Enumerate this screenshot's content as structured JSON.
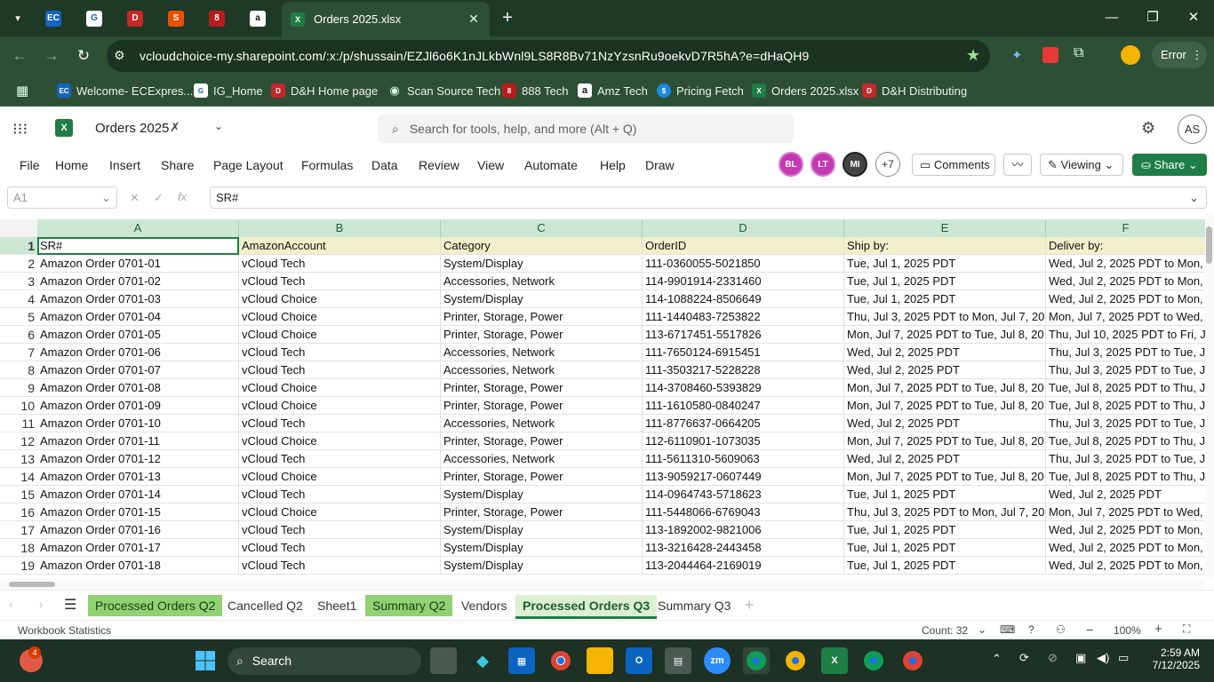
{
  "browser": {
    "active_tab_title": "Orders 2025.xlsx",
    "url": "vcloudchoice-my.sharepoint.com/:x:/p/shussain/EZJl6o6K1nJLkbWnl9LS8R8Bv71NzYzsnRu9oekvD7R5hA?e=dHaQH9",
    "profile_status": "Error",
    "bookmarks": [
      {
        "label": "Welcome- ECExpres...",
        "icon": "ec-icon"
      },
      {
        "label": "IG_Home",
        "icon": "ig-icon"
      },
      {
        "label": "D&H Home page",
        "icon": "dh-icon"
      },
      {
        "label": "Scan Source Tech",
        "icon": "globe-icon"
      },
      {
        "label": "888 Tech",
        "icon": "888-icon"
      },
      {
        "label": "Amz Tech",
        "icon": "amazon-icon"
      },
      {
        "label": "Pricing Fetch",
        "icon": "pricing-icon"
      },
      {
        "label": "Orders 2025.xlsx",
        "icon": "excel-icon"
      },
      {
        "label": "D&H Distributing",
        "icon": "dh-icon"
      }
    ]
  },
  "excel": {
    "workbook_title": "Orders 2025",
    "search_placeholder": "Search for tools, help, and more (Alt + Q)",
    "user_initials": "AS",
    "ribbon_tabs": [
      "File",
      "Home",
      "Insert",
      "Share",
      "Page Layout",
      "Formulas",
      "Data",
      "Review",
      "View",
      "Automate",
      "Help",
      "Draw"
    ],
    "presence": [
      "BL",
      "LT",
      "MI"
    ],
    "presence_more": "+7",
    "comments_label": "Comments",
    "viewing_label": "Viewing",
    "share_label": "Share",
    "name_box": "A1",
    "formula_value": "SR#",
    "columns": [
      "A",
      "B",
      "C",
      "D",
      "E",
      "F"
    ],
    "header_row": [
      "SR#",
      "AmazonAccount",
      "Category",
      "OrderID",
      "Ship by:",
      "Deliver by:"
    ],
    "rows": [
      [
        "2",
        "Amazon Order 0701-01",
        "vCloud Tech",
        "System/Display",
        "111-0360055-5021850",
        "Tue, Jul 1, 2025 PDT",
        "Wed, Jul 2, 2025 PDT to Mon,"
      ],
      [
        "3",
        "Amazon Order 0701-02",
        "vCloud Tech",
        "Accessories, Network",
        "114-9901914-2331460",
        "Tue, Jul 1, 2025 PDT",
        "Wed, Jul 2, 2025 PDT to Mon,"
      ],
      [
        "4",
        "Amazon Order 0701-03",
        "vCloud Choice",
        "System/Display",
        "114-1088224-8506649",
        "Tue, Jul 1, 2025 PDT",
        "Wed, Jul 2, 2025 PDT to Mon,"
      ],
      [
        "5",
        "Amazon Order 0701-04",
        "vCloud Choice",
        "Printer, Storage, Power",
        "111-1440483-7253822",
        "Thu, Jul 3, 2025 PDT to Mon, Jul 7, 20",
        "Mon, Jul 7, 2025 PDT to Wed,"
      ],
      [
        "6",
        "Amazon Order 0701-05",
        "vCloud Choice",
        "Printer, Storage, Power",
        "113-6717451-5517826",
        "Mon, Jul 7, 2025 PDT to Tue, Jul 8, 20",
        "Thu, Jul 10, 2025 PDT to Fri, J"
      ],
      [
        "7",
        "Amazon Order 0701-06",
        "vCloud Tech",
        "Accessories, Network",
        "111-7650124-6915451",
        "Wed, Jul 2, 2025 PDT",
        "Thu, Jul 3, 2025 PDT to Tue, Ju"
      ],
      [
        "8",
        "Amazon Order 0701-07",
        "vCloud Tech",
        "Accessories, Network",
        "111-3503217-5228228",
        "Wed, Jul 2, 2025 PDT",
        "Thu, Jul 3, 2025 PDT to Tue, Ju"
      ],
      [
        "9",
        "Amazon Order 0701-08",
        "vCloud Choice",
        "Printer, Storage, Power",
        "114-3708460-5393829",
        "Mon, Jul 7, 2025 PDT to Tue, Jul 8, 20",
        "Tue, Jul 8, 2025 PDT to Thu, Ju"
      ],
      [
        "10",
        "Amazon Order 0701-09",
        "vCloud Choice",
        "Printer, Storage, Power",
        "111-1610580-0840247",
        "Mon, Jul 7, 2025 PDT to Tue, Jul 8, 20",
        "Tue, Jul 8, 2025 PDT to Thu, Ju"
      ],
      [
        "11",
        "Amazon Order 0701-10",
        "vCloud Tech",
        "Accessories, Network",
        "111-8776637-0664205",
        "Wed, Jul 2, 2025 PDT",
        "Thu, Jul 3, 2025 PDT to Tue, Ju"
      ],
      [
        "12",
        "Amazon Order 0701-11",
        "vCloud Choice",
        "Printer, Storage, Power",
        "112-6110901-1073035",
        "Mon, Jul 7, 2025 PDT to Tue, Jul 8, 20",
        "Tue, Jul 8, 2025 PDT to Thu, Ju"
      ],
      [
        "13",
        "Amazon Order 0701-12",
        "vCloud Tech",
        "Accessories, Network",
        "111-5611310-5609063",
        "Wed, Jul 2, 2025 PDT",
        "Thu, Jul 3, 2025 PDT to Tue, Ju"
      ],
      [
        "14",
        "Amazon Order 0701-13",
        "vCloud Choice",
        "Printer, Storage, Power",
        "113-9059217-0607449",
        "Mon, Jul 7, 2025 PDT to Tue, Jul 8, 20",
        "Tue, Jul 8, 2025 PDT to Thu, Ju"
      ],
      [
        "15",
        "Amazon Order 0701-14",
        "vCloud Tech",
        "System/Display",
        "114-0964743-5718623",
        "Tue, Jul 1, 2025 PDT",
        "Wed, Jul 2, 2025 PDT"
      ],
      [
        "16",
        "Amazon Order 0701-15",
        "vCloud Choice",
        "Printer, Storage, Power",
        "111-5448066-6769043",
        "Thu, Jul 3, 2025 PDT to Mon, Jul 7, 20",
        "Mon, Jul 7, 2025 PDT to Wed,"
      ],
      [
        "17",
        "Amazon Order 0701-16",
        "vCloud Tech",
        "System/Display",
        "113-1892002-9821006",
        "Tue, Jul 1, 2025 PDT",
        "Wed, Jul 2, 2025 PDT to Mon,"
      ],
      [
        "18",
        "Amazon Order 0701-17",
        "vCloud Tech",
        "System/Display",
        "113-3216428-2443458",
        "Tue, Jul 1, 2025 PDT",
        "Wed, Jul 2, 2025 PDT to Mon,"
      ],
      [
        "19",
        "Amazon Order 0701-18",
        "vCloud Tech",
        "System/Display",
        "113-2044464-2169019",
        "Tue, Jul 1, 2025 PDT",
        "Wed, Jul 2, 2025 PDT to Mon,"
      ]
    ],
    "sheets": [
      {
        "label": "Processed Orders Q2",
        "color": "green"
      },
      {
        "label": "Cancelled Q2",
        "color": ""
      },
      {
        "label": "Sheet1",
        "color": ""
      },
      {
        "label": "Summary Q2",
        "color": "green"
      },
      {
        "label": "Vendors",
        "color": ""
      },
      {
        "label": "Processed Orders Q3",
        "color": "active"
      },
      {
        "label": "Summary Q3",
        "color": ""
      }
    ],
    "status_left": "Workbook Statistics",
    "status_count": "Count: 32",
    "zoom": "100%"
  },
  "taskbar": {
    "search_label": "Search",
    "time": "2:59 AM",
    "date": "7/12/2025",
    "notification_badge": "4"
  }
}
